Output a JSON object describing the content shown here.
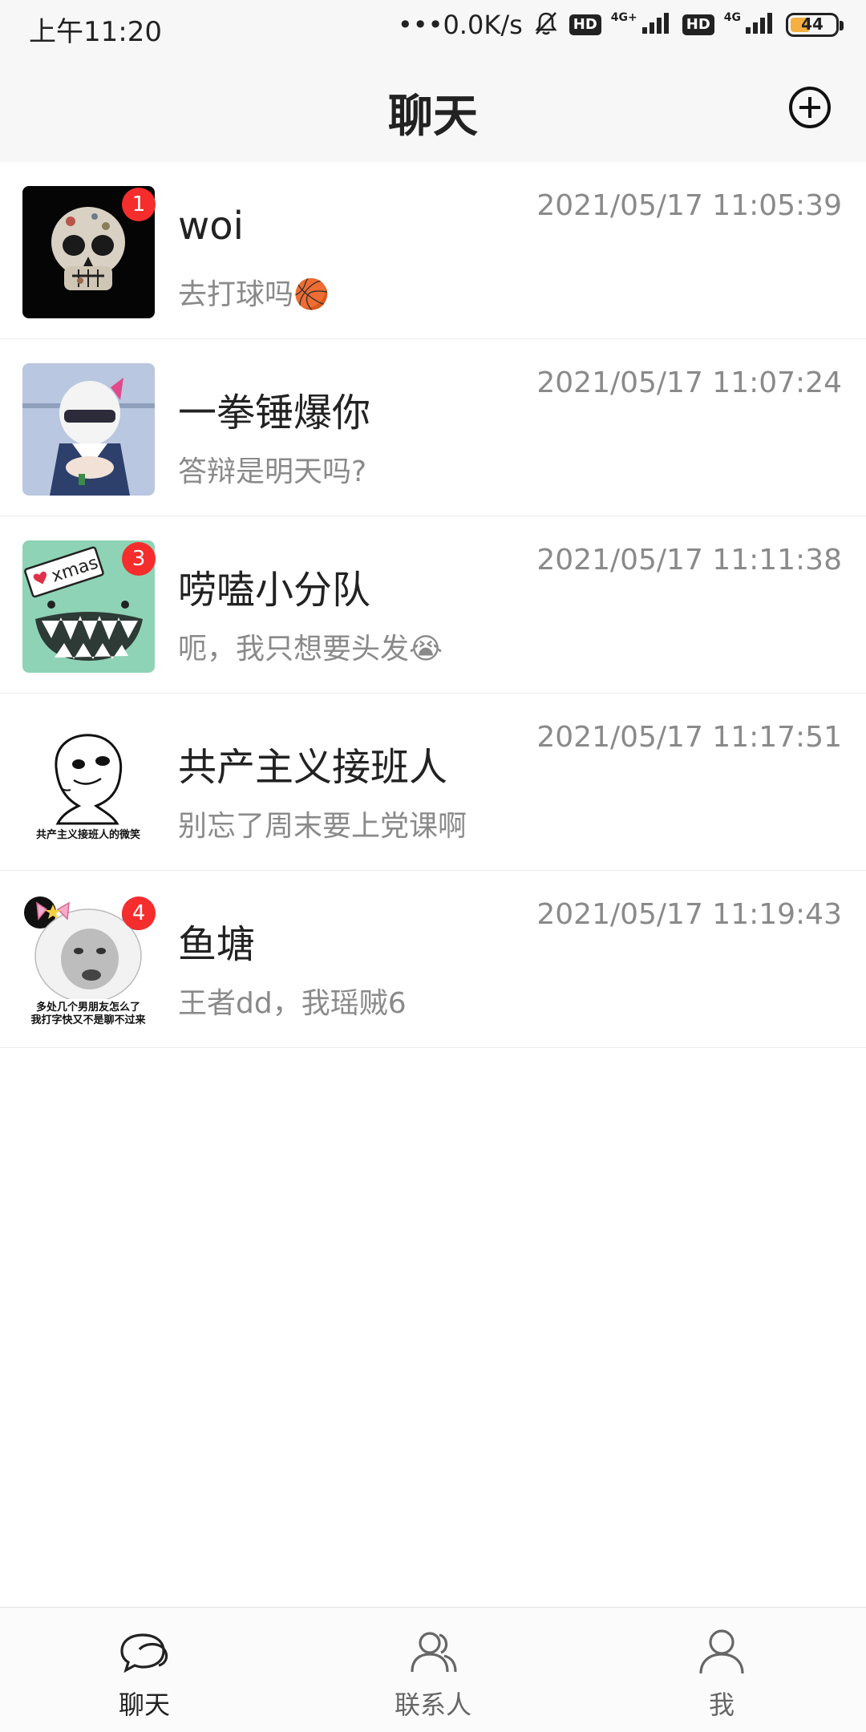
{
  "status_bar": {
    "time": "上午11:20",
    "network_speed": "•••0.0K/s",
    "hd_label": "HD",
    "net1_label": "4G+",
    "net2_label": "4G",
    "battery": "44",
    "battery_level_percent": 44
  },
  "header": {
    "title": "聊天",
    "add_icon": "plus-circle-icon"
  },
  "chats": [
    {
      "name": "woi",
      "preview": "去打球吗🏀",
      "time": "2021/05/17 11:05:39",
      "badge": "1"
    },
    {
      "name": "一拳锤爆你",
      "preview": "答辩是明天吗?",
      "time": "2021/05/17 11:07:24",
      "badge": ""
    },
    {
      "name": "唠嗑小分队",
      "preview": "呃，我只想要头发😭",
      "time": "2021/05/17 11:11:38",
      "badge": "3",
      "avatar_text": "xmas"
    },
    {
      "name": "共产主义接班人",
      "preview": "别忘了周末要上党课啊",
      "time": "2021/05/17 11:17:51",
      "badge": "",
      "avatar_text": "共产主义接班人的微笑"
    },
    {
      "name": "鱼塘",
      "preview": "王者dd，我瑶贼6",
      "time": "2021/05/17 11:19:43",
      "badge": "4",
      "avatar_text_1": "多处几个男朋友怎么了",
      "avatar_text_2": "我打字快又不是聊不过来"
    }
  ],
  "bottom_nav": [
    {
      "label": "聊天",
      "icon": "chat-bubbles-icon",
      "active": true
    },
    {
      "label": "联系人",
      "icon": "contacts-icon",
      "active": false
    },
    {
      "label": "我",
      "icon": "person-icon",
      "active": false
    }
  ],
  "colors": {
    "badge": "#f52d2d",
    "header_bg": "#f7f7f7",
    "preview_text": "#8a8a8a"
  }
}
